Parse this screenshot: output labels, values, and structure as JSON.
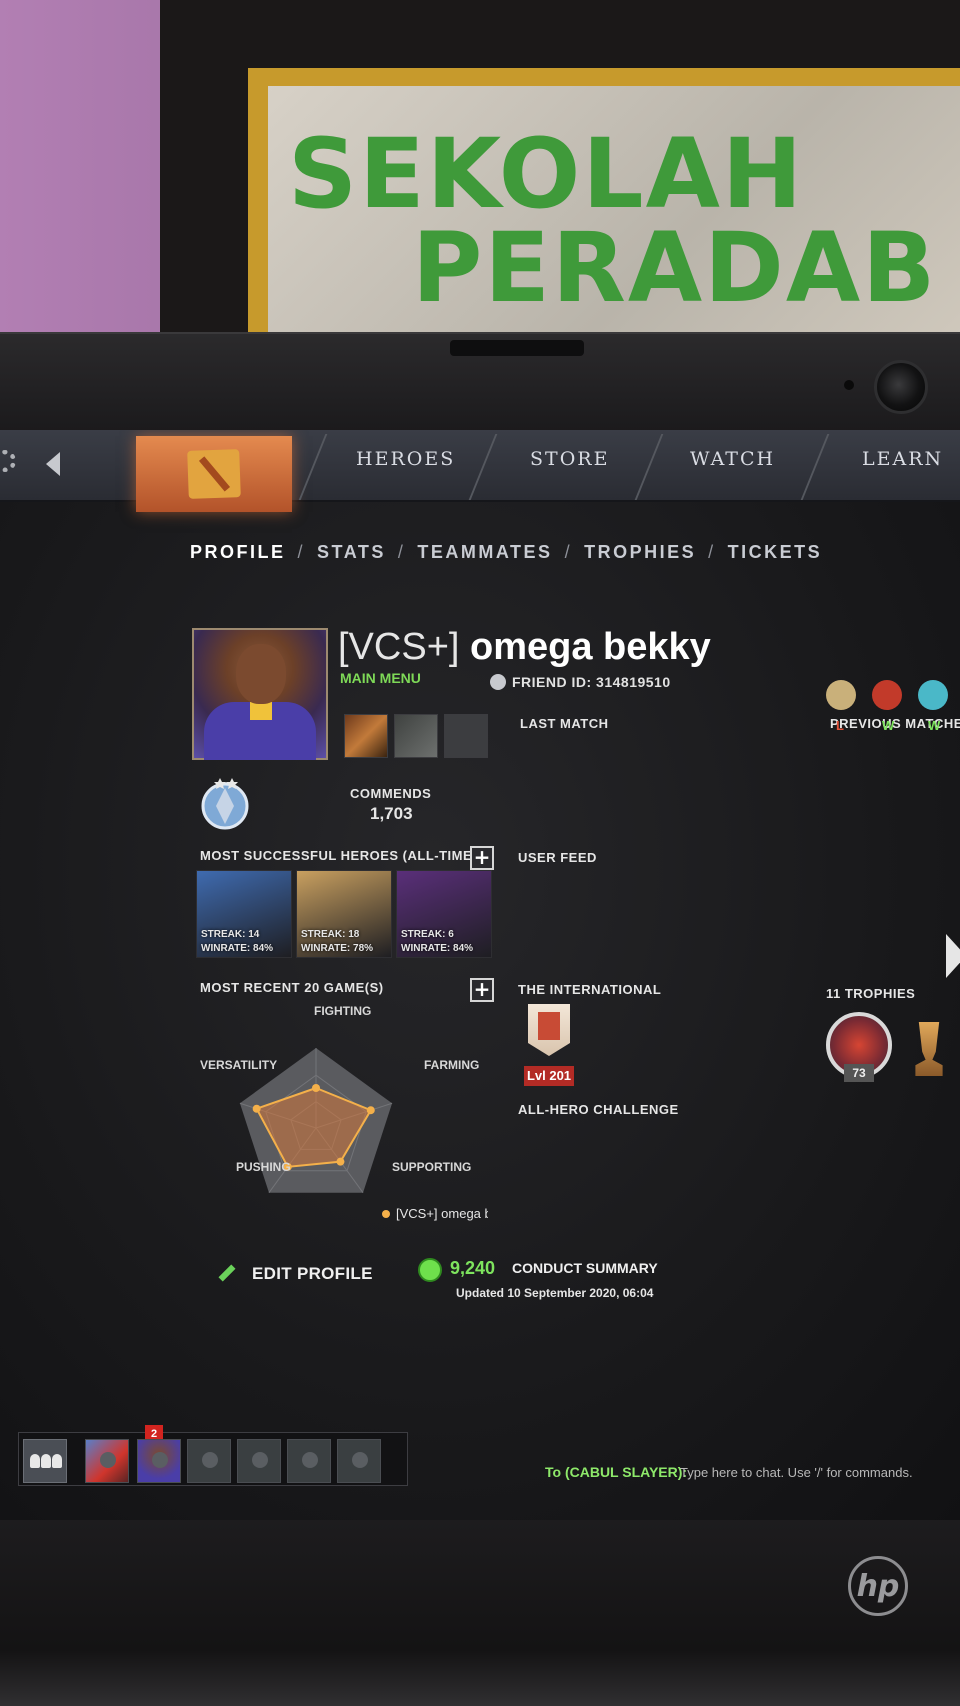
{
  "poster": {
    "line1": "SEKOLAH",
    "line2": "PERADAB"
  },
  "nav": {
    "items": [
      "HEROES",
      "STORE",
      "WATCH",
      "LEARN"
    ]
  },
  "profile_tabs": [
    "PROFILE",
    "STATS",
    "TEAMMATES",
    "TROPHIES",
    "TICKETS"
  ],
  "player": {
    "tag": "[VCS+]",
    "name": "omega bekky",
    "main_menu": "MAIN MENU",
    "friend_id": "FRIEND ID: 314819510"
  },
  "commends": {
    "label": "COMMENDS",
    "value": "1,703"
  },
  "sections": {
    "last_match": "LAST MATCH",
    "previous_matches": "PREVIOUS MATCHES",
    "most_successful": "MOST SUCCESSFUL HEROES (ALL-TIME)",
    "user_feed": "USER FEED",
    "most_recent": "MOST RECENT 20 GAME(S)",
    "the_international": "THE INTERNATIONAL",
    "all_hero": "ALL-HERO CHALLENGE",
    "trophies": "11 TROPHIES"
  },
  "heroes": [
    {
      "streak": "STREAK: 14",
      "winrate": "WINRATE: 84%",
      "color": "#3f6bb0"
    },
    {
      "streak": "STREAK: 18",
      "winrate": "WINRATE: 78%",
      "color": "#c9a060"
    },
    {
      "streak": "STREAK: 6",
      "winrate": "WINRATE: 84%",
      "color": "#5a2f7a"
    }
  ],
  "previous_matches": [
    {
      "result": "L",
      "color": "#e3523a"
    },
    {
      "result": "W",
      "color": "#7ee45e"
    },
    {
      "result": "W",
      "color": "#7ee45e"
    }
  ],
  "radar": {
    "axes": [
      "FIGHTING",
      "FARMING",
      "SUPPORTING",
      "PUSHING",
      "VERSATILITY"
    ],
    "values": [
      0.5,
      0.72,
      0.52,
      0.6,
      0.78
    ],
    "legend": "[VCS+] omega bekky"
  },
  "the_international": {
    "level": "Lvl 201"
  },
  "trophy_count": "73",
  "edit_profile": "EDIT PROFILE",
  "conduct": {
    "score": "9,240",
    "label": "CONDUCT SUMMARY",
    "updated": "Updated 10 September 2020, 06:04"
  },
  "party": {
    "notification_count": "2"
  },
  "chat": {
    "prefix": "To (CABUL SLAYER):",
    "placeholder": "Type here to chat. Use '/' for commands."
  },
  "colors": {
    "accent": "#e48a4f",
    "positive": "#7ee45e",
    "negative": "#e3523a"
  }
}
